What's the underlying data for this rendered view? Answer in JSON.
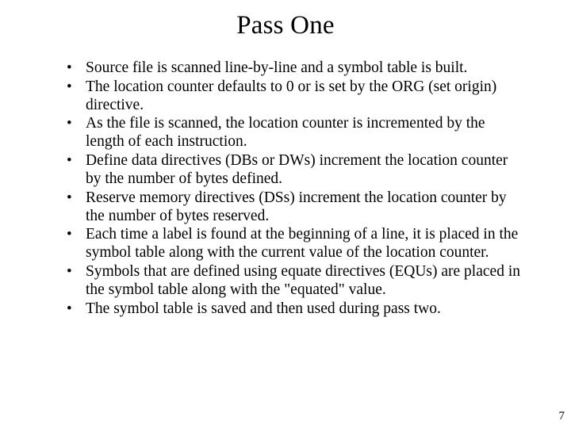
{
  "title": "Pass One",
  "bullets": [
    "Source file is scanned line-by-line and a symbol table is built.",
    "The location counter defaults to 0 or is set by the ORG (set origin) directive.",
    "As the file is scanned, the location counter is incremented by the length of each instruction.",
    "Define data directives (DBs or DWs) increment the location counter by the number of bytes defined.",
    "Reserve memory directives (DSs) increment the location counter by the number of bytes reserved.",
    "Each time a label is found at the beginning of a line, it is placed in the symbol table along with the current value of the location counter.",
    "Symbols that are defined using equate directives (EQUs) are placed in the symbol table along with the \"equated\" value.",
    "The symbol table is saved and then used during pass two."
  ],
  "page_number": "7"
}
